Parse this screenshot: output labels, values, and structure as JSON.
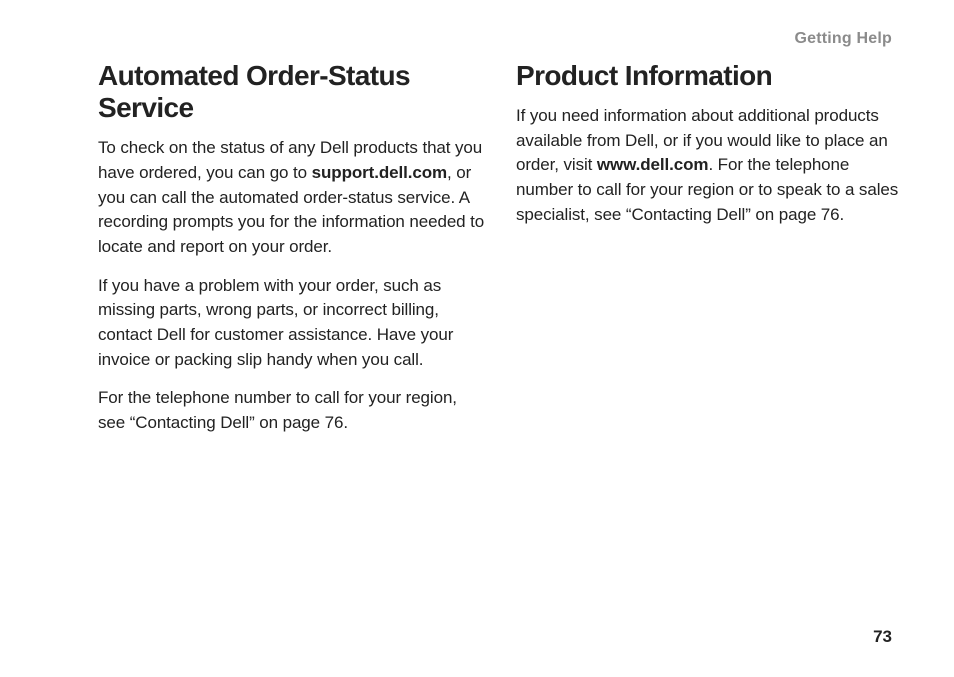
{
  "header": {
    "section_label": "Getting Help"
  },
  "left": {
    "heading": "Automated Order-Status Service",
    "p1_a": "To check on the status of any Dell products that you have ordered, you can go to ",
    "p1_bold": "support.dell.com",
    "p1_b": ", or you can call the automated order-status service. A recording prompts you for the information needed to locate and report on your order.",
    "p2": "If you have a problem with your order, such as missing parts, wrong parts, or incorrect billing, contact Dell for customer assistance. Have your invoice or packing slip handy when you call.",
    "p3": "For the telephone number to call for your region, see “Contacting Dell” on page 76."
  },
  "right": {
    "heading": "Product Information",
    "p1_a": "If you need information about additional products available from Dell, or if you would like to place an order, visit ",
    "p1_bold": "www.dell.com",
    "p1_b": ". For the telephone number to call for your region or to speak to a sales specialist, see “Contacting Dell” on page 76."
  },
  "page_number": "73"
}
